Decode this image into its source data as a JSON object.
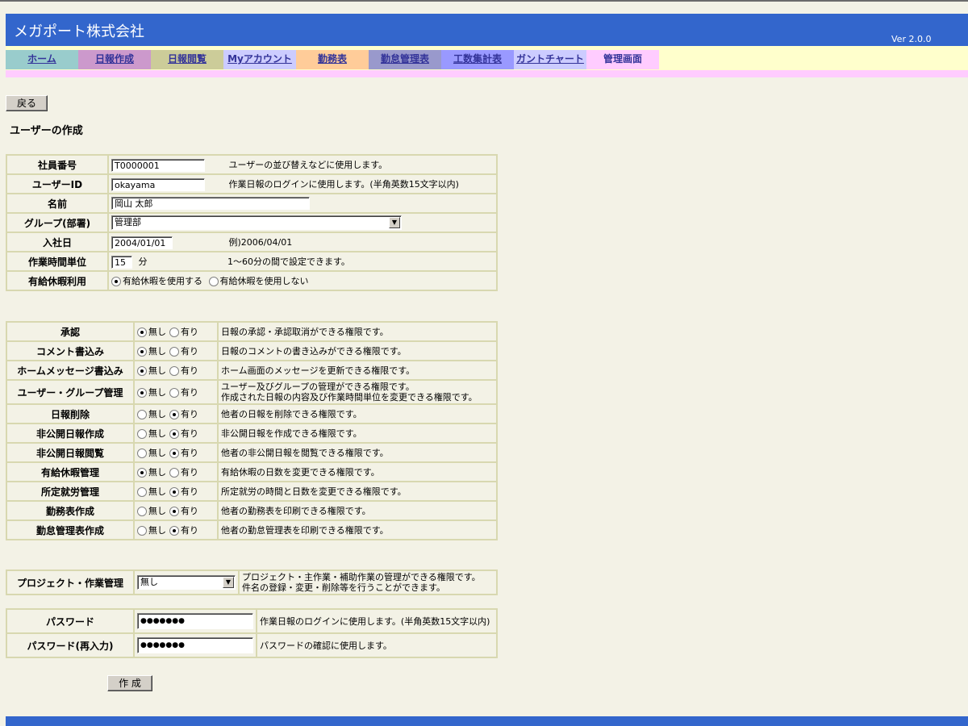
{
  "header": {
    "company": "メガポート株式会社",
    "version": "Ver 2.0.0"
  },
  "nav": {
    "tabs": [
      {
        "label": "ホーム",
        "color": "#99cccc"
      },
      {
        "label": "日報作成",
        "color": "#cc99cc"
      },
      {
        "label": "日報閲覧",
        "color": "#cccc99"
      },
      {
        "label": "Myアカウント",
        "color": "#ccccff"
      },
      {
        "label": "勤務表",
        "color": "#ffcc99"
      },
      {
        "label": "勤怠管理表",
        "color": "#9999cc"
      },
      {
        "label": "工数集計表",
        "color": "#9999ff"
      },
      {
        "label": "ガントチャート",
        "color": "#ccccff"
      },
      {
        "label": "管理画面",
        "color": "#ffccff"
      }
    ]
  },
  "back_button": "戻る",
  "page_title": "ユーザーの作成",
  "form": {
    "employee_no": {
      "label": "社員番号",
      "value": "T0000001",
      "desc": "ユーザーの並び替えなどに使用します。"
    },
    "user_id": {
      "label": "ユーザーID",
      "value": "okayama",
      "desc": "作業日報のログインに使用します。(半角英数15文字以内)"
    },
    "name": {
      "label": "名前",
      "value": "岡山 太郎"
    },
    "group": {
      "label": "グループ(部署)",
      "value": "管理部"
    },
    "join_date": {
      "label": "入社日",
      "value": "2004/01/01",
      "desc": "例)2006/04/01"
    },
    "time_unit": {
      "label": "作業時間単位",
      "value": "15",
      "unit": "分",
      "desc": "1～60分の間で設定できます。"
    },
    "paid_leave_use": {
      "label": "有給休暇利用",
      "opt_yes": "有給休暇を使用する",
      "opt_no": "有給休暇を使用しない"
    }
  },
  "perm_opts": {
    "none": "無し",
    "yes": "有り"
  },
  "permissions": [
    {
      "label": "承認",
      "value": "none",
      "desc": "日報の承認・承認取消ができる権限です。"
    },
    {
      "label": "コメント書込み",
      "value": "none",
      "desc": "日報のコメントの書き込みができる権限です。"
    },
    {
      "label": "ホームメッセージ書込み",
      "value": "none",
      "desc": "ホーム画面のメッセージを更新できる権限です。"
    },
    {
      "label": "ユーザー・グループ管理",
      "value": "none",
      "desc": "ユーザー及びグループの管理ができる権限です。",
      "desc2": "作成された日報の内容及び作業時間単位を変更できる権限です。"
    },
    {
      "label": "日報削除",
      "value": "yes",
      "desc": "他者の日報を削除できる権限です。"
    },
    {
      "label": "非公開日報作成",
      "value": "yes",
      "desc": "非公開日報を作成できる権限です。"
    },
    {
      "label": "非公開日報閲覧",
      "value": "yes",
      "desc": "他者の非公開日報を閲覧できる権限です。"
    },
    {
      "label": "有給休暇管理",
      "value": "none",
      "desc": "有給休暇の日数を変更できる権限です。"
    },
    {
      "label": "所定就労管理",
      "value": "yes",
      "desc": "所定就労の時間と日数を変更できる権限です。"
    },
    {
      "label": "勤務表作成",
      "value": "yes",
      "desc": "他者の勤務表を印刷できる権限です。"
    },
    {
      "label": "勤怠管理表作成",
      "value": "yes",
      "desc": "他者の勤怠管理表を印刷できる権限です。"
    }
  ],
  "project": {
    "label": "プロジェクト・作業管理",
    "value": "無し",
    "desc": "プロジェクト・主作業・補助作業の管理ができる権限です。",
    "desc2": "件名の登録・変更・削除等を行うことができます。"
  },
  "password": {
    "label": "パスワード",
    "value": "●●●●●●●",
    "desc": "作業日報のログインに使用します。(半角英数15文字以内)"
  },
  "password2": {
    "label": "パスワード(再入力)",
    "value": "●●●●●●●",
    "desc": "パスワードの確認に使用します。"
  },
  "create_button": "作 成"
}
